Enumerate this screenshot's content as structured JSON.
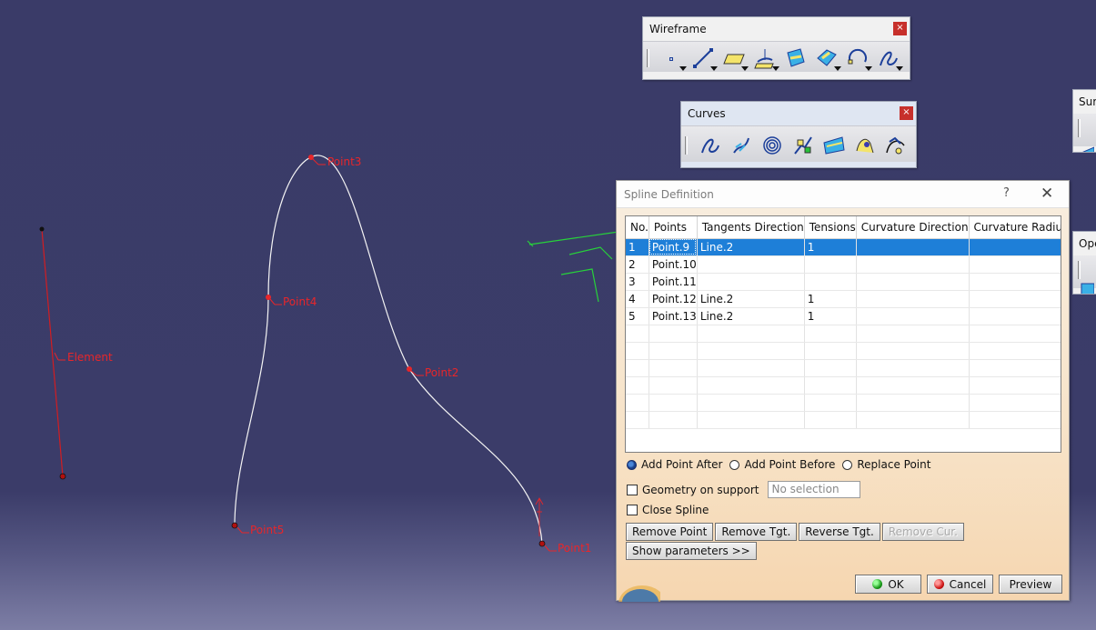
{
  "viewport": {
    "labels": {
      "point3": "Point3",
      "point4": "Point4",
      "point2": "Point2",
      "point5": "Point5",
      "point1": "Point1",
      "element": "Element"
    }
  },
  "toolbars": {
    "wireframe": {
      "title": "Wireframe",
      "close": "×",
      "buttons": [
        "point-icon",
        "line-icon",
        "plane-icon",
        "projection-icon",
        "intersection-icon",
        "offset-surface-icon",
        "circle-icon",
        "spline-icon"
      ]
    },
    "curves": {
      "title": "Curves",
      "close": "×",
      "buttons": [
        "spline-icon",
        "helix-icon",
        "spiral-icon",
        "spine-icon",
        "isoparametric-curve-icon",
        "sketch-curve-icon",
        "3d-curve-icon"
      ]
    },
    "surfaces_partial": {
      "title": "Sur"
    },
    "operations_partial": {
      "title": "Ope"
    }
  },
  "dialog": {
    "title": "Spline Definition",
    "help": "?",
    "close": "✕",
    "table": {
      "columns": [
        "No.",
        "Points",
        "Tangents Direction",
        "Tensions",
        "Curvature Direction",
        "Curvature Radius"
      ],
      "rows": [
        [
          "1",
          "Point.9",
          "Line.2",
          "1",
          "",
          ""
        ],
        [
          "2",
          "Point.10",
          "",
          "",
          "",
          ""
        ],
        [
          "3",
          "Point.11",
          "",
          "",
          "",
          ""
        ],
        [
          "4",
          "Point.12",
          "Line.2",
          "1",
          "",
          ""
        ],
        [
          "5",
          "Point.13",
          "Line.2",
          "1",
          "",
          ""
        ]
      ],
      "selected_row": 0
    },
    "radios": {
      "add_after": "Add Point After",
      "add_before": "Add Point Before",
      "replace": "Replace Point",
      "selected": "add_after"
    },
    "geometry_on_support": "Geometry on support",
    "support_placeholder": "No selection",
    "close_spline": "Close Spline",
    "buttons": {
      "remove_point": "Remove Point",
      "remove_tgt": "Remove Tgt.",
      "reverse_tgt": "Reverse Tgt.",
      "remove_cur": "Remove Cur.",
      "show_parameters": "Show parameters >>",
      "ok": "OK",
      "cancel": "Cancel",
      "preview": "Preview"
    }
  },
  "colors": {
    "background_top": "#3a3b68",
    "label_red": "#e8262a",
    "selection_blue": "#1e7fd8",
    "dialog_bg": "#f7e3c8"
  }
}
